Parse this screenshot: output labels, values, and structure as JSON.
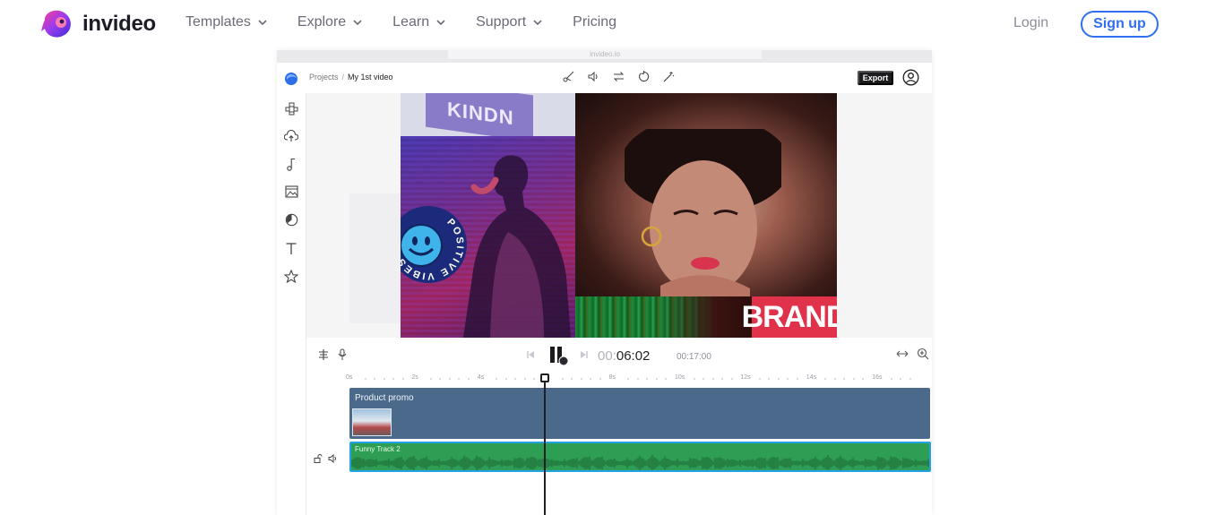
{
  "brand": {
    "name": "invideo"
  },
  "nav": {
    "items": [
      {
        "label": "Templates",
        "has_dropdown": true
      },
      {
        "label": "Explore",
        "has_dropdown": true
      },
      {
        "label": "Learn",
        "has_dropdown": true
      },
      {
        "label": "Support",
        "has_dropdown": true
      },
      {
        "label": "Pricing",
        "has_dropdown": false
      }
    ],
    "login_label": "Login",
    "signup_label": "Sign up"
  },
  "colors": {
    "accent": "#2f6ff0",
    "timeline_clip": "#4b6a8b",
    "audio_track": "#2f9e55",
    "audio_border": "#23a3e6",
    "brand_tile": "#e0334b"
  },
  "editor": {
    "browser_url": "invideo.io",
    "breadcrumb": {
      "root": "Projects",
      "separator": "/",
      "current": "My 1st video"
    },
    "toolbar_icons": [
      "scissors-icon",
      "volume-icon",
      "swap-icon",
      "rotate-icon",
      "magic-wand-icon"
    ],
    "export_label": "Export",
    "sidebar_icons": [
      "layouts-icon",
      "upload-icon",
      "music-icon",
      "media-icon",
      "sticker-icon",
      "text-icon",
      "star-icon"
    ],
    "preview": {
      "flag_text": "KINDN",
      "badge_text": "POSITIVE VIBES",
      "brand_text": "BRAND"
    },
    "timeline": {
      "time_current_prefix": "00:",
      "time_current_main": "06:02",
      "time_total": "00:17:00",
      "ruler_labels": [
        "0s",
        "2s",
        "4s",
        "6s",
        "8s",
        "10s",
        "12s",
        "14s",
        "16s"
      ],
      "video_track_label": "Product promo",
      "audio_track_label": "Funny Track 2",
      "playhead_seconds": 6.03
    }
  }
}
